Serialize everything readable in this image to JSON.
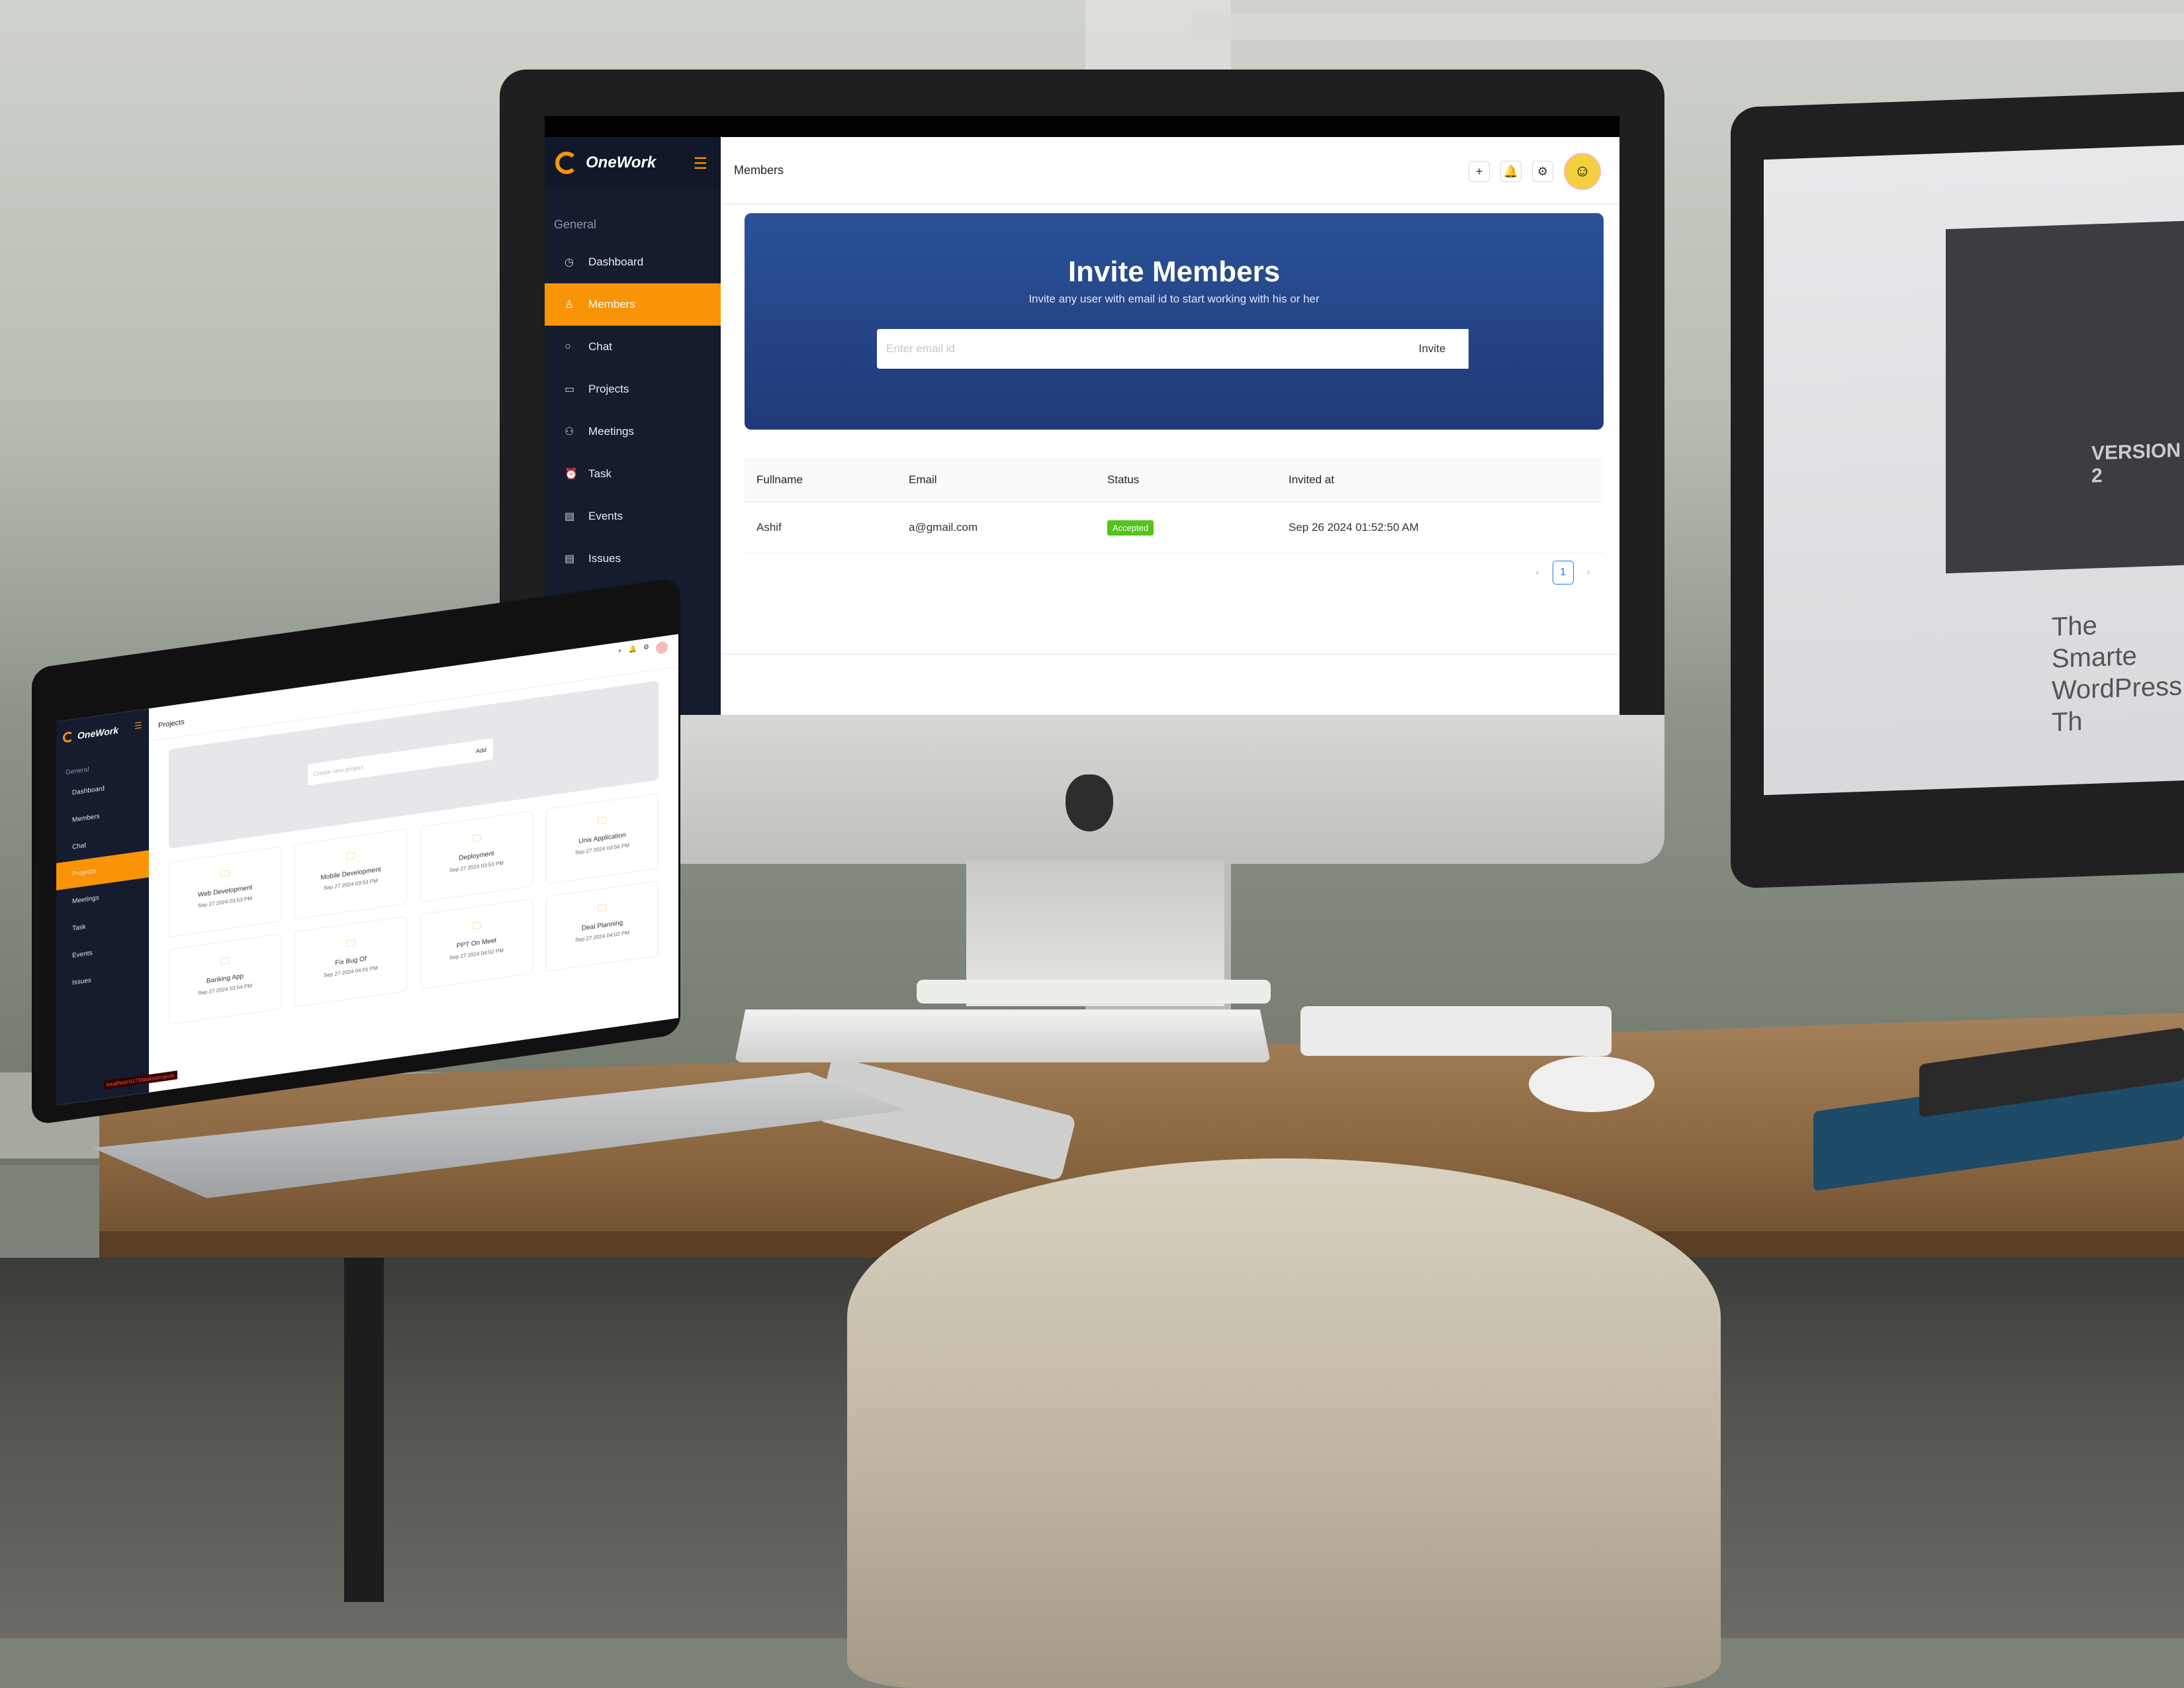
{
  "desktop_app": {
    "brand": "OneWork",
    "section_label": "General",
    "nav": [
      {
        "label": "Dashboard",
        "icon": "dashboard-icon",
        "active": false
      },
      {
        "label": "Members",
        "icon": "user-icon",
        "active": true
      },
      {
        "label": "Chat",
        "icon": "chat-icon",
        "active": false
      },
      {
        "label": "Projects",
        "icon": "monitor-icon",
        "active": false
      },
      {
        "label": "Meetings",
        "icon": "meetings-icon",
        "active": false
      },
      {
        "label": "Task",
        "icon": "alarm-icon",
        "active": false
      },
      {
        "label": "Events",
        "icon": "calendar-icon",
        "active": false
      },
      {
        "label": "Issues",
        "icon": "calendar-icon",
        "active": false
      }
    ],
    "page_title": "Members",
    "header_icons": [
      "plus-icon",
      "bell-icon",
      "gear-icon",
      "avatar"
    ],
    "banner": {
      "title": "Invite Members",
      "subtitle": "Invite any user with email id to start working with his or her",
      "input_placeholder": "Enter email id",
      "button": "Invite"
    },
    "table": {
      "columns": [
        "Fullname",
        "Email",
        "Status",
        "Invited at"
      ],
      "rows": [
        {
          "fullname": "Ashif",
          "email": "a@gmail.com",
          "status": "Accepted",
          "invited_at": "Sep 26 2024 01:52:50 AM"
        }
      ]
    },
    "pagination": {
      "current": "1"
    },
    "colors": {
      "sidebar": "#141c2e",
      "accent": "#f89406",
      "banner": "#2b5198",
      "status_accepted": "#52c41a"
    }
  },
  "laptop_app": {
    "brand": "OneWork",
    "section_label": "General",
    "nav": [
      "Dashboard",
      "Members",
      "Chat",
      "Projects",
      "Meetings",
      "Task",
      "Events",
      "Issues"
    ],
    "active_nav": "Projects",
    "page_title": "Projects",
    "input_placeholder": "Create new project",
    "add_button": "Add",
    "projects": [
      {
        "name": "Web Development",
        "date": "Sep 27 2024 03:53 PM"
      },
      {
        "name": "Mobile Development",
        "date": "Sep 27 2024 03:53 PM"
      },
      {
        "name": "Deployment",
        "date": "Sep 27 2024 03:53 PM"
      },
      {
        "name": "Unix Application",
        "date": "Sep 27 2024 03:56 PM"
      },
      {
        "name": "Banking App",
        "date": "Sep 27 2024 03:54 PM"
      },
      {
        "name": "Fix Bug Of",
        "date": "Sep 27 2024 04:01 PM"
      },
      {
        "name": "PPT On Meet",
        "date": "Sep 27 2024 04:02 PM"
      },
      {
        "name": "Deal Planning",
        "date": "Sep 27 2024 04:02 PM"
      }
    ],
    "url_text": "localhost:5173/tasks/projects"
  },
  "side_monitor": {
    "version_text": "VERSION 2",
    "headline": "The Smarte WordPress Th"
  }
}
